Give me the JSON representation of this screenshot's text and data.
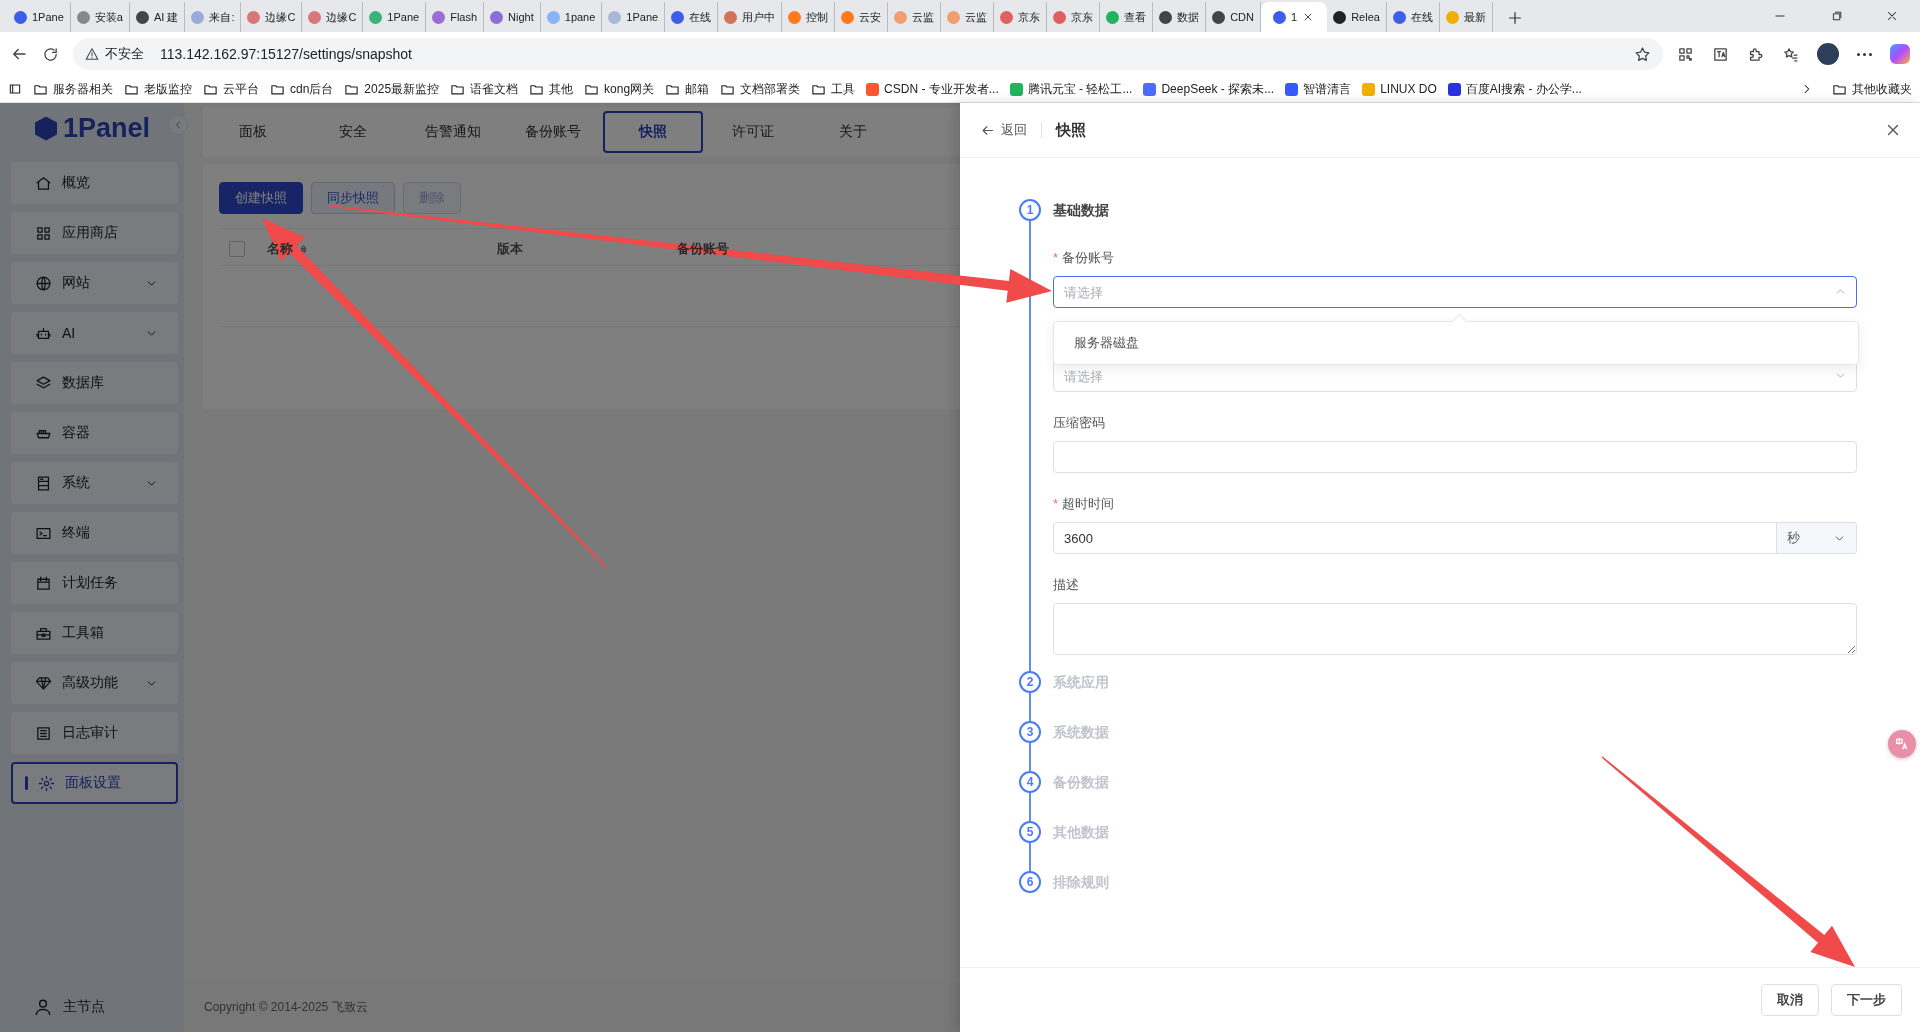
{
  "browser": {
    "tabs": [
      {
        "title": "1Pane",
        "color": "#3d5ee6",
        "selected": false
      },
      {
        "title": "安装a",
        "color": "#888888",
        "selected": false
      },
      {
        "title": "AI 建",
        "color": "#444444",
        "selected": false
      },
      {
        "title": "来自:",
        "color": "#99aadd",
        "selected": false
      },
      {
        "title": "边缘C",
        "color": "#d77777",
        "selected": false
      },
      {
        "title": "边缘C",
        "color": "#d77777",
        "selected": false
      },
      {
        "title": "1Pane",
        "color": "#3bb27a",
        "selected": false
      },
      {
        "title": "Flash",
        "color": "#9b6bd6",
        "selected": false
      },
      {
        "title": "Night",
        "color": "#8a6fd8",
        "selected": false
      },
      {
        "title": "1pane",
        "color": "#8ab4f8",
        "selected": false
      },
      {
        "title": "1Pane",
        "color": "#aab8d8",
        "selected": false
      },
      {
        "title": "在线",
        "color": "#3d5ee6",
        "selected": false
      },
      {
        "title": "用户中",
        "color": "#d0735c",
        "selected": false
      },
      {
        "title": "控制",
        "color": "#ff7a1a",
        "selected": false
      },
      {
        "title": "云安",
        "color": "#ff7a1a",
        "selected": false
      },
      {
        "title": "云监",
        "color": "#f0a070",
        "selected": false
      },
      {
        "title": "云监",
        "color": "#f0a070",
        "selected": false
      },
      {
        "title": "京东",
        "color": "#e06060",
        "selected": false
      },
      {
        "title": "京东",
        "color": "#e06060",
        "selected": false
      },
      {
        "title": "查看",
        "color": "#22b35e",
        "selected": false
      },
      {
        "title": "数据",
        "color": "#444444",
        "selected": false
      },
      {
        "title": "CDN",
        "color": "#444444",
        "selected": false
      },
      {
        "title": "1",
        "color": "#3d5ee6",
        "selected": true
      },
      {
        "title": "Relea",
        "color": "#222222",
        "selected": false
      },
      {
        "title": "在线",
        "color": "#3d5ee6",
        "selected": false
      },
      {
        "title": "最新",
        "color": "#f0b000",
        "selected": false
      }
    ],
    "address": {
      "security": "不安全",
      "url": "113.142.162.97:15127/settings/snapshot"
    },
    "bookmarks": [
      {
        "label": "服务器相关",
        "kind": "folder"
      },
      {
        "label": "老版监控",
        "kind": "folder"
      },
      {
        "label": "云平台",
        "kind": "folder"
      },
      {
        "label": "cdn后台",
        "kind": "folder"
      },
      {
        "label": "2025最新监控",
        "kind": "folder"
      },
      {
        "label": "语雀文档",
        "kind": "folder"
      },
      {
        "label": "其他",
        "kind": "folder"
      },
      {
        "label": "kong网关",
        "kind": "folder"
      },
      {
        "label": "邮箱",
        "kind": "folder"
      },
      {
        "label": "文档部署类",
        "kind": "folder"
      },
      {
        "label": "工具",
        "kind": "folder"
      },
      {
        "label": "CSDN - 专业开发者...",
        "kind": "link",
        "color": "#fc5531"
      },
      {
        "label": "腾讯元宝 - 轻松工...",
        "kind": "link",
        "color": "#22b35e"
      },
      {
        "label": "DeepSeek - 探索未...",
        "kind": "link",
        "color": "#4d6bfe"
      },
      {
        "label": "智谱清言",
        "kind": "link",
        "color": "#3859ff"
      },
      {
        "label": "LINUX DO",
        "kind": "link",
        "color": "#f0b000"
      },
      {
        "label": "百度AI搜索 - 办公学...",
        "kind": "link",
        "color": "#2932e1"
      }
    ],
    "other_bookmarks": "其他收藏夹"
  },
  "app": {
    "logo": "1Panel",
    "sidebar": {
      "items": [
        {
          "label": "概览",
          "kind": "link",
          "selected": false
        },
        {
          "label": "应用商店",
          "kind": "link",
          "selected": false
        },
        {
          "label": "网站",
          "kind": "group",
          "selected": false
        },
        {
          "label": "AI",
          "kind": "group",
          "selected": false
        },
        {
          "label": "数据库",
          "kind": "link",
          "selected": false
        },
        {
          "label": "容器",
          "kind": "link",
          "selected": false
        },
        {
          "label": "系统",
          "kind": "group",
          "selected": false
        },
        {
          "label": "终端",
          "kind": "link",
          "selected": false
        },
        {
          "label": "计划任务",
          "kind": "link",
          "selected": false
        },
        {
          "label": "工具箱",
          "kind": "link",
          "selected": false
        },
        {
          "label": "高级功能",
          "kind": "group",
          "selected": false
        },
        {
          "label": "日志审计",
          "kind": "link",
          "selected": false
        },
        {
          "label": "面板设置",
          "kind": "link",
          "selected": true
        }
      ],
      "node": "主节点"
    },
    "settings_tabs": [
      {
        "label": "面板",
        "selected": false
      },
      {
        "label": "安全",
        "selected": false
      },
      {
        "label": "告警通知",
        "selected": false
      },
      {
        "label": "备份账号",
        "selected": false
      },
      {
        "label": "快照",
        "selected": true
      },
      {
        "label": "许可证",
        "selected": false
      },
      {
        "label": "关于",
        "selected": false
      }
    ],
    "toolbar": [
      {
        "label": "创建快照",
        "kind": "primary",
        "disabled": false
      },
      {
        "label": "同步快照",
        "kind": "default",
        "disabled": false
      },
      {
        "label": "删除",
        "kind": "default",
        "disabled": true
      }
    ],
    "table": {
      "select_all_checked": false,
      "columns": [
        {
          "label": "名称",
          "sortable": true
        },
        {
          "label": "版本",
          "sortable": false
        },
        {
          "label": "备份账号",
          "sortable": false
        }
      ]
    },
    "footer": "Copyright © 2014-2025 飞致云"
  },
  "drawer": {
    "back": "返回",
    "title": "快照",
    "steps": [
      {
        "number": "1",
        "title": "基础数据",
        "active": true
      },
      {
        "number": "2",
        "title": "系统应用",
        "active": false
      },
      {
        "number": "3",
        "title": "系统数据",
        "active": false
      },
      {
        "number": "4",
        "title": "备份数据",
        "active": false
      },
      {
        "number": "5",
        "title": "其他数据",
        "active": false
      },
      {
        "number": "6",
        "title": "排除规则",
        "active": false
      }
    ],
    "fields": [
      {
        "kind": "select",
        "label": "备份账号",
        "required_mark": "*",
        "placeholder": "请选择",
        "open": true,
        "options": [
          "服务器磁盘"
        ]
      },
      {
        "kind": "select",
        "placeholder": "请选择",
        "open": false
      },
      {
        "kind": "input",
        "label": "压缩密码"
      },
      {
        "kind": "input-unit",
        "label": "超时时间",
        "required_mark": "*",
        "value": "3600",
        "unit": "秒"
      },
      {
        "kind": "textarea",
        "label": "描述"
      }
    ],
    "buttons": [
      "取消",
      "下一步"
    ]
  }
}
